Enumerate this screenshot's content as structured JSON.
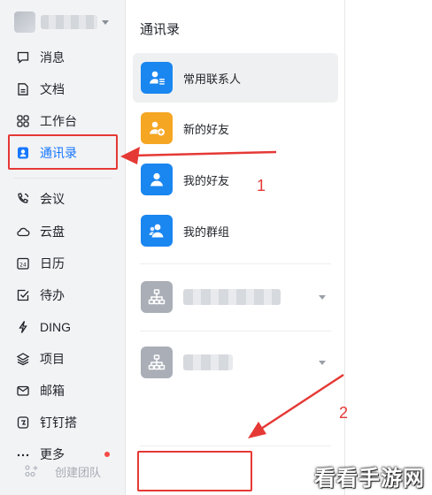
{
  "sidebar": {
    "items": [
      {
        "label": "消息",
        "icon": "chat-bubble-icon"
      },
      {
        "label": "文档",
        "icon": "document-icon"
      },
      {
        "label": "工作台",
        "icon": "grid-icon"
      },
      {
        "label": "通讯录",
        "icon": "contacts-icon",
        "active": true
      },
      {
        "label": "会议",
        "icon": "phone-icon"
      },
      {
        "label": "云盘",
        "icon": "cloud-icon"
      },
      {
        "label": "日历",
        "icon": "calendar-icon",
        "badge": "24"
      },
      {
        "label": "待办",
        "icon": "checkbox-icon"
      },
      {
        "label": "DING",
        "icon": "lightning-icon"
      },
      {
        "label": "项目",
        "icon": "layers-icon"
      },
      {
        "label": "邮箱",
        "icon": "mail-icon"
      },
      {
        "label": "钉钉搭",
        "icon": "app-builder-icon"
      },
      {
        "label": "更多",
        "icon": "more-dots-icon"
      }
    ]
  },
  "contacts": {
    "title": "通讯录",
    "rows": [
      {
        "label": "常用联系人",
        "icon": "frequent-contacts-icon"
      },
      {
        "label": "新的好友",
        "icon": "add-friend-icon"
      },
      {
        "label": "我的好友",
        "icon": "friend-icon"
      },
      {
        "label": "我的群组",
        "icon": "group-icon"
      }
    ],
    "create_team": "创建团队"
  },
  "annotations": {
    "one": "1",
    "two": "2"
  },
  "colors": {
    "accent": "#1677ff",
    "highlight": "#e53935",
    "orange": "#f5a623",
    "blue": "#1a86f0"
  },
  "watermark": "看看手游网"
}
